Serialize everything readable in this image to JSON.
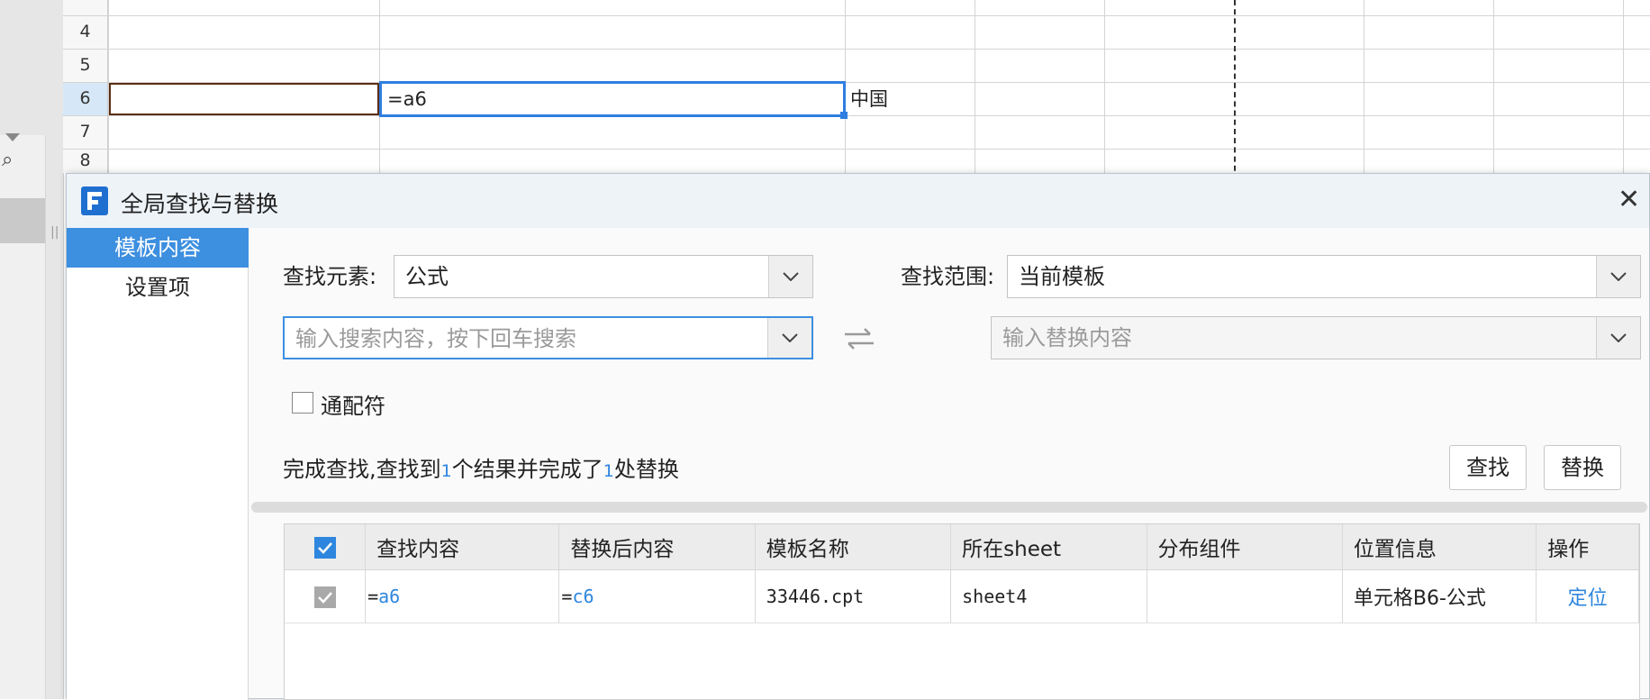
{
  "spreadsheet": {
    "rows": [
      {
        "num": "4"
      },
      {
        "num": "5"
      },
      {
        "num": "6"
      },
      {
        "num": "7"
      },
      {
        "num": "8"
      }
    ],
    "active_cell_value": "=a6",
    "adjacent_cell_value": "中国"
  },
  "dialog": {
    "title": "全局查找与替换",
    "nav": [
      {
        "label": "模板内容"
      },
      {
        "label": "设置项"
      }
    ],
    "find_element_label": "查找元素:",
    "find_element_value": "公式",
    "find_scope_label": "查找范围:",
    "find_scope_value": "当前模板",
    "search_placeholder": "输入搜索内容，按下回车搜索",
    "replace_placeholder": "输入替换内容",
    "wildcard_label": "通配符",
    "status": {
      "prefix": "完成查找,查找到",
      "found_count": "1",
      "middle": "个结果并完成了",
      "replaced_count": "1",
      "suffix": "处替换"
    },
    "find_button": "查找",
    "replace_button": "替换",
    "table": {
      "headers": [
        "查找内容",
        "替换后内容",
        "模板名称",
        "所在sheet",
        "分布组件",
        "位置信息",
        "操作"
      ],
      "rows": [
        {
          "find_prefix": "=",
          "find_ref": "a6",
          "replace_prefix": "=",
          "replace_ref": "c6",
          "template": "33446.cpt",
          "sheet": "sheet4",
          "component": "",
          "position": "单元格B6-公式",
          "action": "定位"
        }
      ]
    }
  },
  "colors": {
    "accent": "#2e86de",
    "nav_active": "#3d8fe0",
    "cell_selection": "#2f7ee0"
  }
}
